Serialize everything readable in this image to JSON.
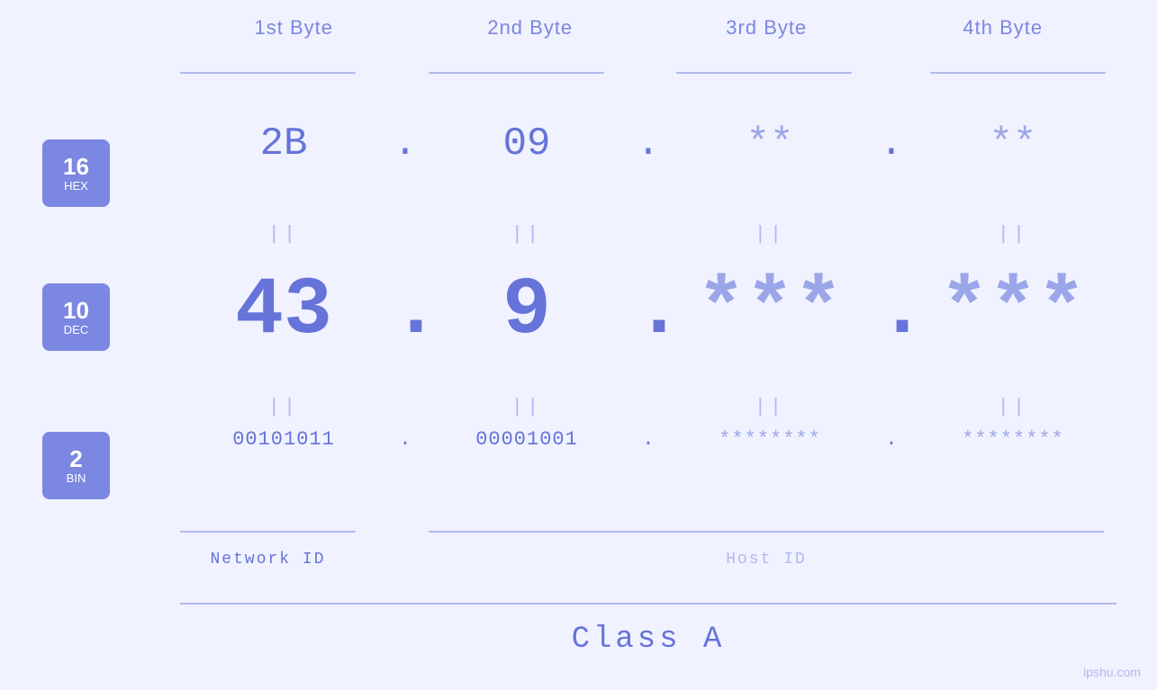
{
  "headers": {
    "byte1": "1st Byte",
    "byte2": "2nd Byte",
    "byte3": "3rd Byte",
    "byte4": "4th Byte"
  },
  "badges": {
    "hex": {
      "num": "16",
      "label": "HEX"
    },
    "dec": {
      "num": "10",
      "label": "DEC"
    },
    "bin": {
      "num": "2",
      "label": "BIN"
    }
  },
  "hex_row": {
    "b1": "2B",
    "b2": "09",
    "b3": "**",
    "b4": "**",
    "dot": "."
  },
  "dec_row": {
    "b1": "43",
    "b2": "9",
    "b3": "***",
    "b4": "***",
    "dot": "."
  },
  "bin_row": {
    "b1": "00101011",
    "b2": "00001001",
    "b3": "********",
    "b4": "********",
    "dot": "."
  },
  "equals": "||",
  "labels": {
    "network_id": "Network ID",
    "host_id": "Host ID",
    "class": "Class A"
  },
  "watermark": "ipshu.com"
}
